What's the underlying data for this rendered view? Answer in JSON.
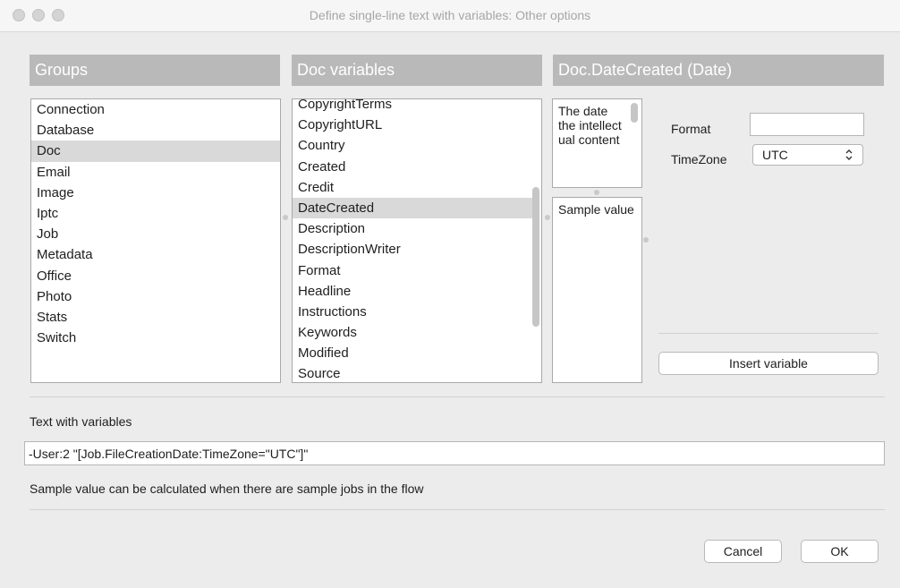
{
  "window": {
    "title": "Define single-line text with variables: Other options"
  },
  "groups": {
    "header": "Groups",
    "items": [
      "Connection",
      "Database",
      "Doc",
      "Email",
      "Image",
      "Iptc",
      "Job",
      "Metadata",
      "Office",
      "Photo",
      "Stats",
      "Switch"
    ],
    "selected": "Doc"
  },
  "doc_variables": {
    "header": "Doc variables",
    "items": [
      "CopyrightTerms",
      "CopyrightURL",
      "Country",
      "Created",
      "Credit",
      "DateCreated",
      "Description",
      "DescriptionWriter",
      "Format",
      "Headline",
      "Instructions",
      "Keywords",
      "Modified",
      "Source"
    ],
    "selected": "DateCreated"
  },
  "detail": {
    "header": "Doc.DateCreated (Date)",
    "description": "The date the intellect ual content",
    "sample_value": "Sample value",
    "format_label": "Format",
    "format_value": "",
    "timezone_label": "TimeZone",
    "timezone_value": "UTC",
    "insert_button": "Insert variable"
  },
  "text_with_variables": {
    "label": "Text with variables",
    "value": "-User:2 \"[Job.FileCreationDate:TimeZone=\"UTC\"]\""
  },
  "hint": "Sample value can be calculated when there are sample jobs in the flow",
  "buttons": {
    "cancel": "Cancel",
    "ok": "OK"
  }
}
